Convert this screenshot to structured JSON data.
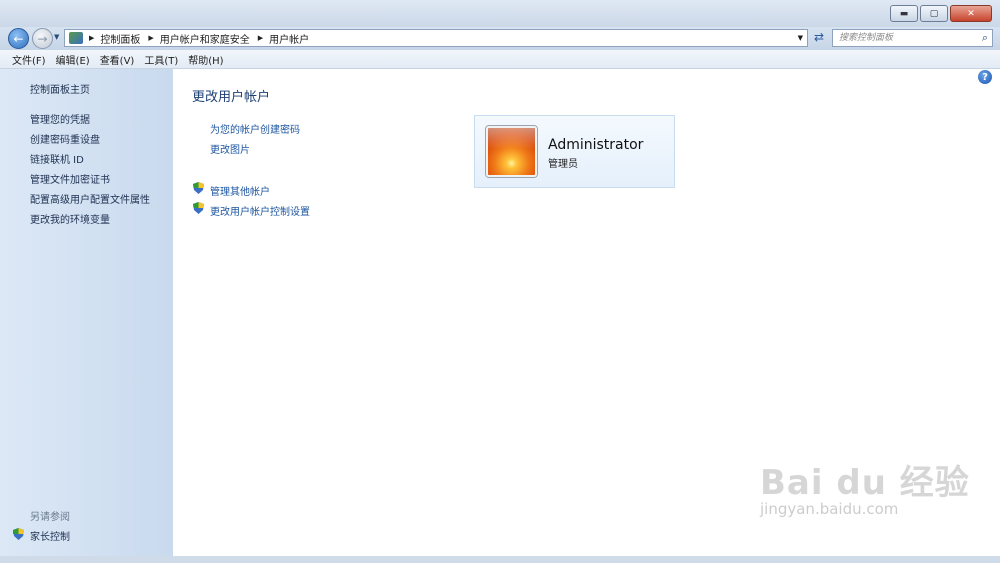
{
  "window": {
    "controls": {
      "minimize": "▬",
      "maximize": "▢",
      "close": "✕"
    }
  },
  "address": {
    "crumbs": [
      "控制面板",
      "用户帐户和家庭安全",
      "用户帐户"
    ]
  },
  "search": {
    "placeholder": "搜索控制面板"
  },
  "menu": [
    "文件(F)",
    "编辑(E)",
    "查看(V)",
    "工具(T)",
    "帮助(H)"
  ],
  "sidebar": {
    "home": "控制面板主页",
    "items": [
      "管理您的凭据",
      "创建密码重设盘",
      "链接联机 ID",
      "管理文件加密证书",
      "配置高级用户配置文件属性",
      "更改我的环境变量"
    ],
    "see_also_title": "另请参阅",
    "see_also_items": [
      "家长控制"
    ]
  },
  "main": {
    "title": "更改用户帐户",
    "tasks": [
      "为您的帐户创建密码",
      "更改图片"
    ],
    "shield_tasks": [
      "管理其他帐户",
      "更改用户帐户控制设置"
    ]
  },
  "account": {
    "name": "Administrator",
    "role": "管理员"
  },
  "watermark": {
    "logo": "Bai du 经验",
    "url": "jingyan.baidu.com"
  },
  "colors": {
    "link": "#1e56a0",
    "heading": "#1d3f73",
    "sidebar_bg": "#dce8f6",
    "close_btn": "#c7432c"
  },
  "icons": [
    "back-arrow-icon",
    "forward-arrow-icon",
    "control-panel-icon",
    "refresh-icon",
    "search-icon",
    "shield-icon",
    "help-icon"
  ]
}
